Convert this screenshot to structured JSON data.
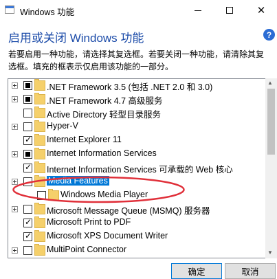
{
  "window": {
    "title": "Windows 功能",
    "header": "启用或关闭 Windows 功能",
    "description": "若要启用一种功能，请选择其复选框。若要关闭一种功能，请清除其复选框。填充的框表示仅启用该功能的一部分。",
    "help_symbol": "?"
  },
  "features": [
    {
      "label": ".NET Framework 3.5 (包括 .NET 2.0 和 3.0)",
      "state": "partial",
      "expander": true
    },
    {
      "label": ".NET Framework 4.7 高级服务",
      "state": "partial",
      "expander": true
    },
    {
      "label": "Active Directory 轻型目录服务",
      "state": "unchecked",
      "expander": false
    },
    {
      "label": "Hyper-V",
      "state": "unchecked",
      "expander": true
    },
    {
      "label": "Internet Explorer 11",
      "state": "checked",
      "expander": false
    },
    {
      "label": "Internet Information Services",
      "state": "partial",
      "expander": true
    },
    {
      "label": "Internet Information Services 可承载的 Web 核心",
      "state": "checked",
      "expander": false
    },
    {
      "label": "Media Features",
      "state": "unchecked",
      "expander": true,
      "selected": true
    },
    {
      "label": "Windows Media Player",
      "state": "unchecked",
      "expander": false,
      "child": true
    },
    {
      "label": "Microsoft Message Queue (MSMQ) 服务器",
      "state": "unchecked",
      "expander": true
    },
    {
      "label": "Microsoft Print to PDF",
      "state": "checked",
      "expander": false
    },
    {
      "label": "Microsoft XPS Document Writer",
      "state": "checked",
      "expander": false
    },
    {
      "label": "MultiPoint Connector",
      "state": "unchecked",
      "expander": true
    }
  ],
  "buttons": {
    "ok": "确定",
    "cancel": "取消"
  },
  "annotation": {
    "color": "#e0303a",
    "shape": "ellipse"
  }
}
